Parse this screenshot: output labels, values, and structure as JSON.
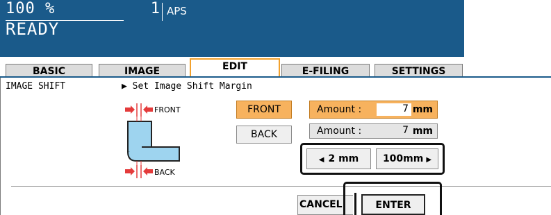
{
  "status": {
    "zoom": "100 %",
    "copies": "1",
    "paper": "APS",
    "state": "READY"
  },
  "tabs": [
    {
      "label": "BASIC",
      "active": false
    },
    {
      "label": "IMAGE",
      "active": false
    },
    {
      "label": "EDIT",
      "active": true
    },
    {
      "label": "E-FILING",
      "active": false
    },
    {
      "label": "SETTINGS",
      "active": false
    }
  ],
  "breadcrumb": {
    "function": "IMAGE SHIFT",
    "instruction": "▶ Set Image Shift Margin"
  },
  "diagram": {
    "front_label": "FRONT",
    "back_label": "BACK"
  },
  "controls": {
    "front_button": "FRONT",
    "back_button": "BACK",
    "front_amount_label": "Amount :",
    "front_amount_value": "7",
    "back_amount_label": "Amount :",
    "back_amount_value": "7",
    "unit": "mm",
    "decrease_button": "2 mm",
    "increase_button": "100mm"
  },
  "footer": {
    "cancel_button": "CANCEL",
    "enter_button": "ENTER"
  },
  "colors": {
    "status_bar": "#1a5a8a",
    "active_orange": "#f7b25e",
    "active_tab_border": "#f2a12d",
    "arrow_red": "#e43b3b",
    "paper_blue": "#9ed4ef"
  }
}
